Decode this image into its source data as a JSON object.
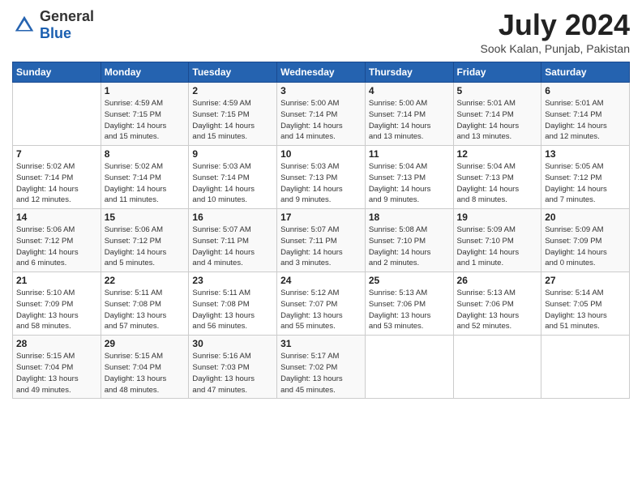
{
  "header": {
    "logo_general": "General",
    "logo_blue": "Blue",
    "title": "July 2024",
    "location": "Sook Kalan, Punjab, Pakistan"
  },
  "calendar": {
    "days_header": [
      "Sunday",
      "Monday",
      "Tuesday",
      "Wednesday",
      "Thursday",
      "Friday",
      "Saturday"
    ],
    "weeks": [
      [
        {
          "day": "",
          "info": ""
        },
        {
          "day": "1",
          "info": "Sunrise: 4:59 AM\nSunset: 7:15 PM\nDaylight: 14 hours\nand 15 minutes."
        },
        {
          "day": "2",
          "info": "Sunrise: 4:59 AM\nSunset: 7:15 PM\nDaylight: 14 hours\nand 15 minutes."
        },
        {
          "day": "3",
          "info": "Sunrise: 5:00 AM\nSunset: 7:14 PM\nDaylight: 14 hours\nand 14 minutes."
        },
        {
          "day": "4",
          "info": "Sunrise: 5:00 AM\nSunset: 7:14 PM\nDaylight: 14 hours\nand 13 minutes."
        },
        {
          "day": "5",
          "info": "Sunrise: 5:01 AM\nSunset: 7:14 PM\nDaylight: 14 hours\nand 13 minutes."
        },
        {
          "day": "6",
          "info": "Sunrise: 5:01 AM\nSunset: 7:14 PM\nDaylight: 14 hours\nand 12 minutes."
        }
      ],
      [
        {
          "day": "7",
          "info": "Sunrise: 5:02 AM\nSunset: 7:14 PM\nDaylight: 14 hours\nand 12 minutes."
        },
        {
          "day": "8",
          "info": "Sunrise: 5:02 AM\nSunset: 7:14 PM\nDaylight: 14 hours\nand 11 minutes."
        },
        {
          "day": "9",
          "info": "Sunrise: 5:03 AM\nSunset: 7:14 PM\nDaylight: 14 hours\nand 10 minutes."
        },
        {
          "day": "10",
          "info": "Sunrise: 5:03 AM\nSunset: 7:13 PM\nDaylight: 14 hours\nand 9 minutes."
        },
        {
          "day": "11",
          "info": "Sunrise: 5:04 AM\nSunset: 7:13 PM\nDaylight: 14 hours\nand 9 minutes."
        },
        {
          "day": "12",
          "info": "Sunrise: 5:04 AM\nSunset: 7:13 PM\nDaylight: 14 hours\nand 8 minutes."
        },
        {
          "day": "13",
          "info": "Sunrise: 5:05 AM\nSunset: 7:12 PM\nDaylight: 14 hours\nand 7 minutes."
        }
      ],
      [
        {
          "day": "14",
          "info": "Sunrise: 5:06 AM\nSunset: 7:12 PM\nDaylight: 14 hours\nand 6 minutes."
        },
        {
          "day": "15",
          "info": "Sunrise: 5:06 AM\nSunset: 7:12 PM\nDaylight: 14 hours\nand 5 minutes."
        },
        {
          "day": "16",
          "info": "Sunrise: 5:07 AM\nSunset: 7:11 PM\nDaylight: 14 hours\nand 4 minutes."
        },
        {
          "day": "17",
          "info": "Sunrise: 5:07 AM\nSunset: 7:11 PM\nDaylight: 14 hours\nand 3 minutes."
        },
        {
          "day": "18",
          "info": "Sunrise: 5:08 AM\nSunset: 7:10 PM\nDaylight: 14 hours\nand 2 minutes."
        },
        {
          "day": "19",
          "info": "Sunrise: 5:09 AM\nSunset: 7:10 PM\nDaylight: 14 hours\nand 1 minute."
        },
        {
          "day": "20",
          "info": "Sunrise: 5:09 AM\nSunset: 7:09 PM\nDaylight: 14 hours\nand 0 minutes."
        }
      ],
      [
        {
          "day": "21",
          "info": "Sunrise: 5:10 AM\nSunset: 7:09 PM\nDaylight: 13 hours\nand 58 minutes."
        },
        {
          "day": "22",
          "info": "Sunrise: 5:11 AM\nSunset: 7:08 PM\nDaylight: 13 hours\nand 57 minutes."
        },
        {
          "day": "23",
          "info": "Sunrise: 5:11 AM\nSunset: 7:08 PM\nDaylight: 13 hours\nand 56 minutes."
        },
        {
          "day": "24",
          "info": "Sunrise: 5:12 AM\nSunset: 7:07 PM\nDaylight: 13 hours\nand 55 minutes."
        },
        {
          "day": "25",
          "info": "Sunrise: 5:13 AM\nSunset: 7:06 PM\nDaylight: 13 hours\nand 53 minutes."
        },
        {
          "day": "26",
          "info": "Sunrise: 5:13 AM\nSunset: 7:06 PM\nDaylight: 13 hours\nand 52 minutes."
        },
        {
          "day": "27",
          "info": "Sunrise: 5:14 AM\nSunset: 7:05 PM\nDaylight: 13 hours\nand 51 minutes."
        }
      ],
      [
        {
          "day": "28",
          "info": "Sunrise: 5:15 AM\nSunset: 7:04 PM\nDaylight: 13 hours\nand 49 minutes."
        },
        {
          "day": "29",
          "info": "Sunrise: 5:15 AM\nSunset: 7:04 PM\nDaylight: 13 hours\nand 48 minutes."
        },
        {
          "day": "30",
          "info": "Sunrise: 5:16 AM\nSunset: 7:03 PM\nDaylight: 13 hours\nand 47 minutes."
        },
        {
          "day": "31",
          "info": "Sunrise: 5:17 AM\nSunset: 7:02 PM\nDaylight: 13 hours\nand 45 minutes."
        },
        {
          "day": "",
          "info": ""
        },
        {
          "day": "",
          "info": ""
        },
        {
          "day": "",
          "info": ""
        }
      ]
    ]
  }
}
